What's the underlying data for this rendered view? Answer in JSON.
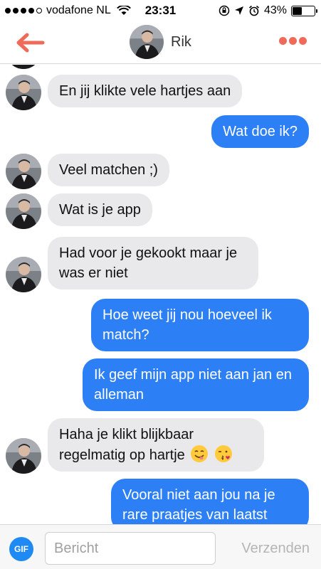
{
  "status_bar": {
    "carrier": "vodafone NL",
    "time": "23:31",
    "battery": "43%",
    "battery_level": 0.43
  },
  "header": {
    "contact_name": "Rik",
    "icons": [
      "back-arrow-icon",
      "more-options-icon"
    ]
  },
  "messages": [
    {
      "from": "them",
      "text": "En jij klikte vele hartjes aan"
    },
    {
      "from": "me",
      "text": "Wat doe ik?"
    },
    {
      "from": "them",
      "text": "Veel matchen ;)"
    },
    {
      "from": "them",
      "text": "Wat is je app"
    },
    {
      "from": "them",
      "text": "Had voor je gekookt maar je was er niet"
    },
    {
      "from": "me",
      "text": "Hoe weet jij nou hoeveel ik match?"
    },
    {
      "from": "me",
      "text": "Ik geef mijn app niet aan jan en alleman"
    },
    {
      "from": "them",
      "text": "Haha je klikt blijkbaar regelmatig op hartje",
      "emojis": [
        "smiling-face-emoji",
        "face-blowing-kiss-emoji"
      ]
    },
    {
      "from": "me",
      "text": "Vooral niet aan jou na je rare praatjes van laatst"
    }
  ],
  "composer": {
    "gif_label": "GIF",
    "placeholder": "Bericht",
    "send_label": "Verzenden"
  }
}
